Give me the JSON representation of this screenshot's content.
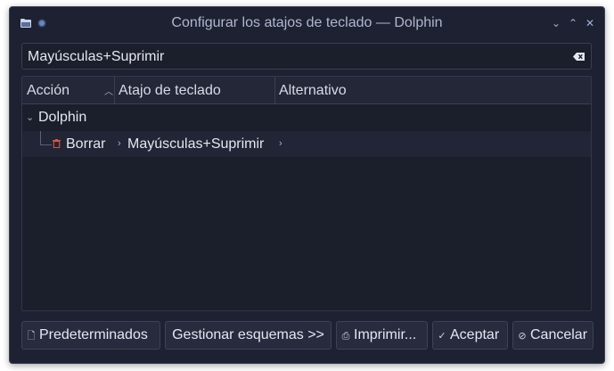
{
  "window": {
    "title": "Configurar los atajos de teclado — Dolphin",
    "controls": {
      "minimize": "⌄",
      "maximize": "⌃",
      "close": "✕"
    }
  },
  "search": {
    "value": "Mayúsculas+Suprimir",
    "clear_icon": "backspace-clear-icon"
  },
  "table": {
    "columns": [
      "Acción",
      "Atajo de teclado",
      "Alternativo"
    ],
    "sort_indicator": "^",
    "groups": [
      {
        "name": "Dolphin",
        "expanded": true,
        "rows": [
          {
            "action": "Borrar",
            "icon": "trash-icon",
            "shortcut": "Mayúsculas+Suprimir",
            "alternate": ""
          }
        ]
      }
    ]
  },
  "buttons": {
    "defaults": "Predeterminados",
    "schemes": "Gestionar esquemas >>",
    "print": "Imprimir...",
    "accept": "Aceptar",
    "cancel": "Cancelar"
  },
  "colors": {
    "window_bg": "#1e2131",
    "accent": "#9fb0d8",
    "trash_icon": "#d8573c"
  }
}
